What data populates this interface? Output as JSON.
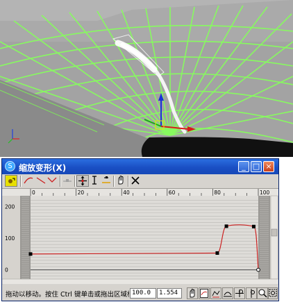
{
  "window": {
    "title": "缩放变形(X)",
    "icon_glyph": "S",
    "minimize_glyph": "_",
    "maximize_glyph": "□",
    "close_glyph": "×"
  },
  "toolbar": {
    "icons": [
      "filter-icon",
      "curve-line-icon",
      "straight-line-icon",
      "reset-curve-icon",
      "insert-point-icon",
      "move-icon",
      "scale-point-icon",
      "insert-corner-icon",
      "pan-icon",
      "delete-point-icon"
    ]
  },
  "graph": {
    "x_ticks": [
      "0",
      "20",
      "40",
      "60",
      "80",
      "100"
    ],
    "y_ticks": [
      "200",
      "100",
      "0"
    ],
    "curve_color": "#cc2020",
    "point_color": "#000000"
  },
  "chart_data": {
    "type": "line",
    "title": "",
    "xlabel": "",
    "ylabel": "",
    "xlim": [
      0,
      100
    ],
    "ylim": [
      -25,
      230
    ],
    "x": [
      0,
      82,
      86,
      98,
      100
    ],
    "y": [
      50,
      53,
      138,
      137,
      0
    ],
    "series": [
      {
        "values": [
          50,
          53,
          138,
          137,
          0
        ]
      }
    ]
  },
  "statusbar": {
    "message": "拖动以移动。按住 Ctrl 键单击或拖出区域框以选择",
    "x_value": "100.0",
    "y_value": "1.554"
  },
  "colors": {
    "viewport_bg": "#9e9e9e",
    "wire_green": "#7cff50",
    "titlebar_blue": "#2b6fe0",
    "panel_gray": "#d6d3ce"
  }
}
